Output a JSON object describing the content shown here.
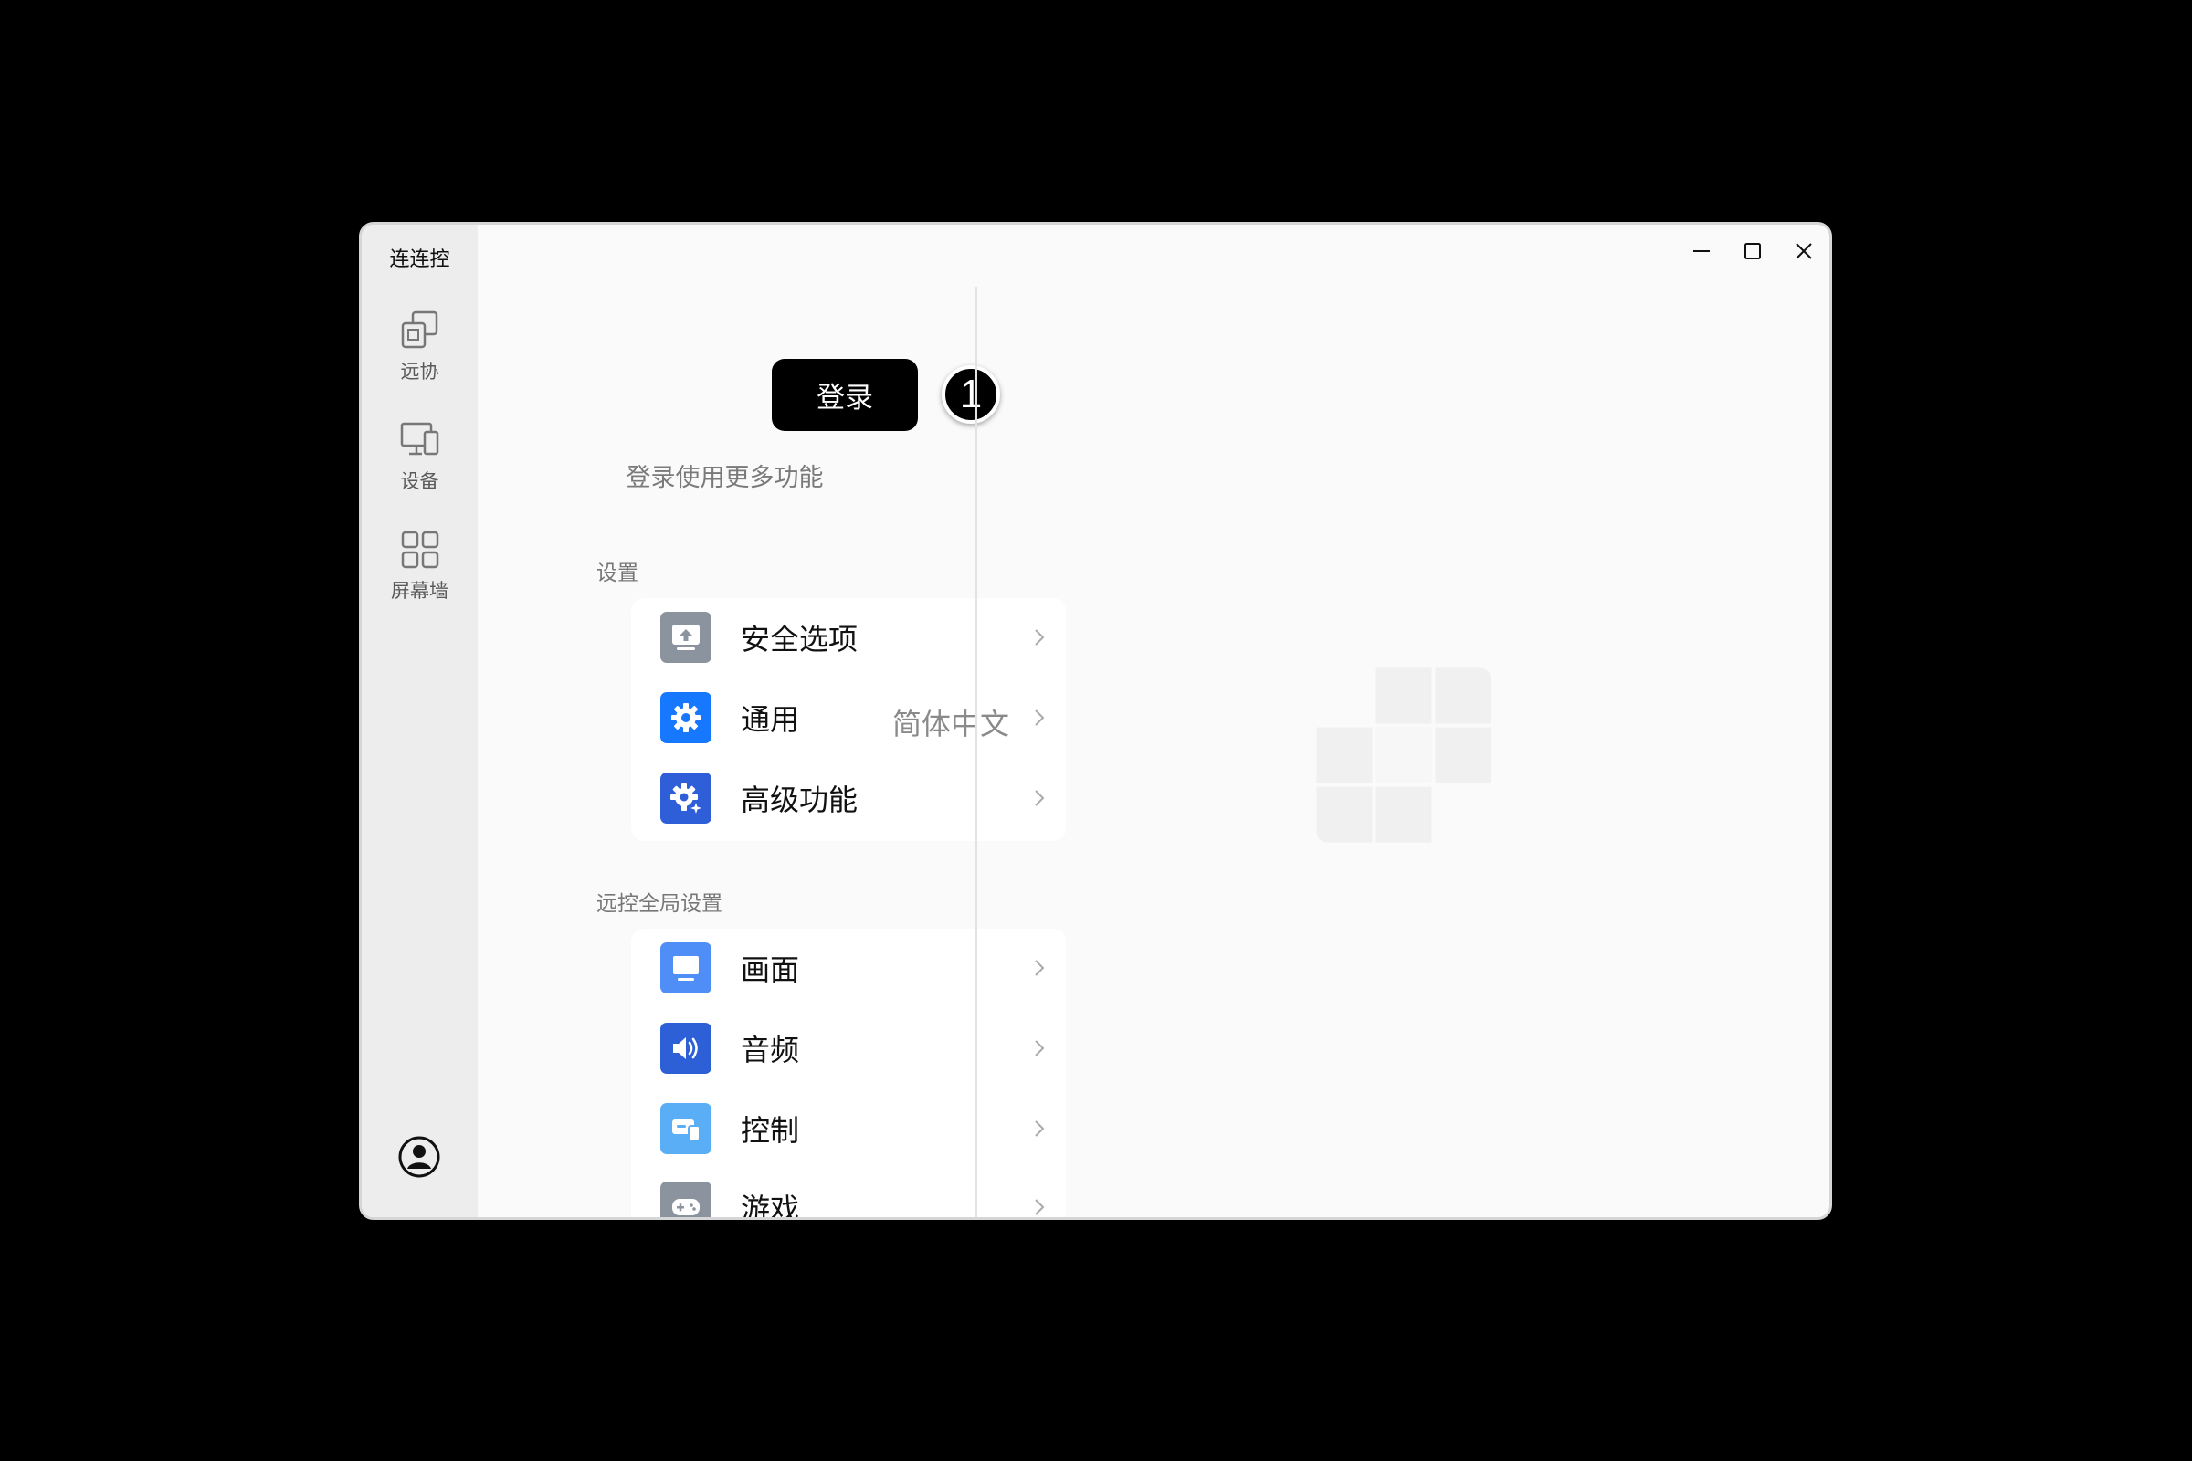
{
  "app": {
    "title": "连连控"
  },
  "nav": {
    "items": [
      {
        "label": "远协",
        "icon": "remote-assist-icon"
      },
      {
        "label": "设备",
        "icon": "devices-icon"
      },
      {
        "label": "屏幕墙",
        "icon": "screen-wall-grid-icon"
      }
    ],
    "account_icon": "user-avatar-icon"
  },
  "window_controls": [
    "minimize-icon",
    "maximize-icon",
    "close-icon"
  ],
  "login": {
    "button_label": "登录",
    "step_badge": "1",
    "hint": "登录使用更多功能"
  },
  "settings": {
    "title": "设置",
    "items": [
      {
        "label": "安全选项",
        "value": "",
        "icon": "security-upload-icon",
        "color": "#8a939e"
      },
      {
        "label": "通用",
        "value": "简体中文",
        "icon": "gear-icon",
        "color": "#1677ff"
      },
      {
        "label": "高级功能",
        "value": "",
        "icon": "advanced-gear-icon",
        "color": "#2e5fd8"
      }
    ]
  },
  "remote_global": {
    "title": "远控全局设置",
    "items": [
      {
        "label": "画面",
        "icon": "monitor-icon",
        "color": "#4f8ef7"
      },
      {
        "label": "音频",
        "icon": "speaker-icon",
        "color": "#2d5fd6"
      },
      {
        "label": "控制",
        "icon": "control-device-icon",
        "color": "#5aaef5"
      },
      {
        "label": "游戏",
        "icon": "gamepad-icon",
        "color": "#8a939e"
      }
    ]
  }
}
